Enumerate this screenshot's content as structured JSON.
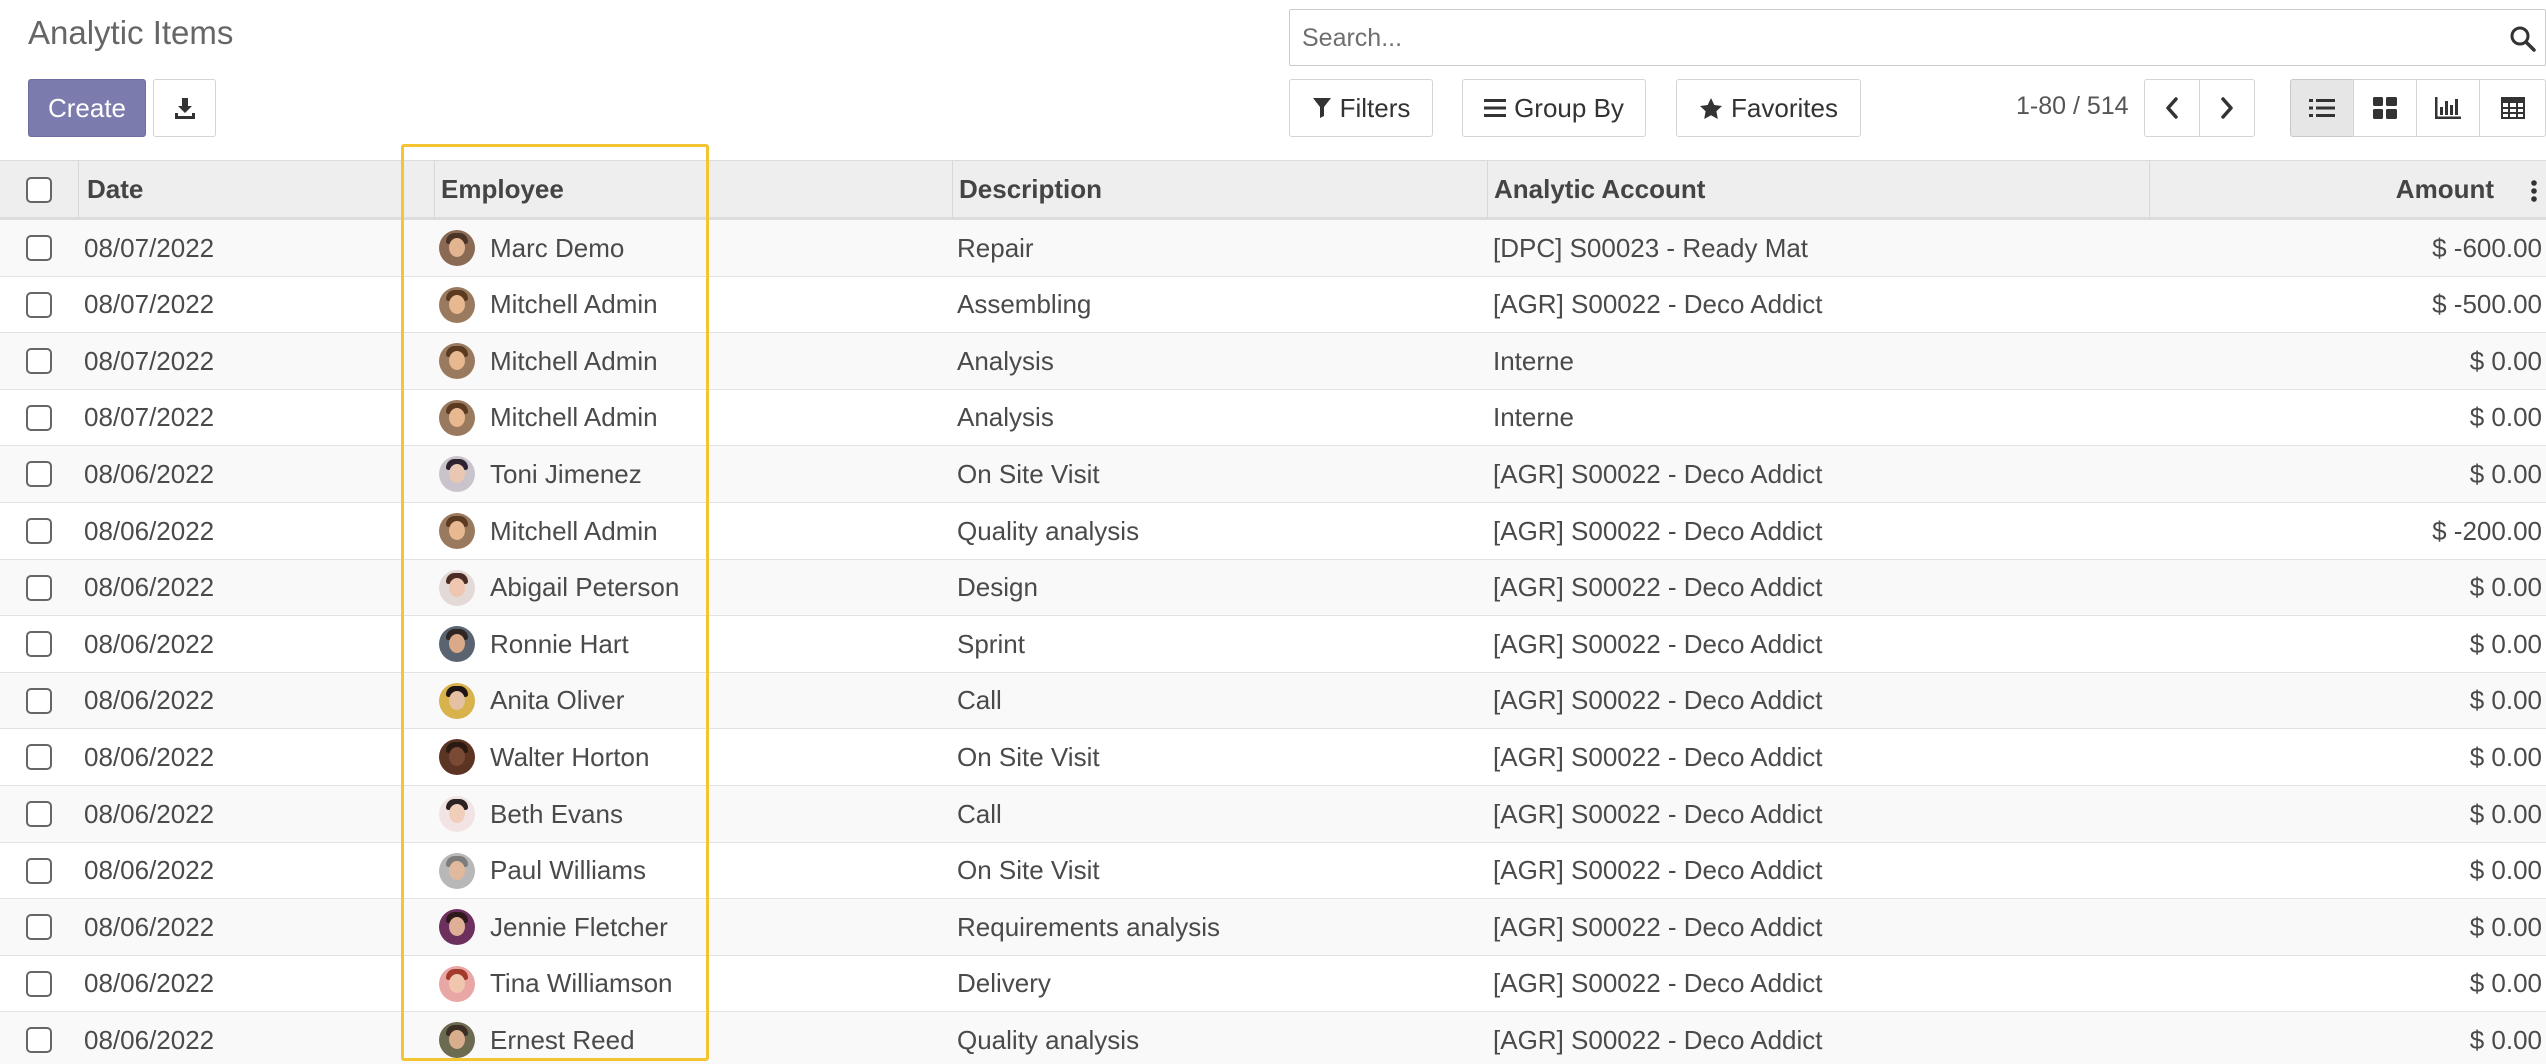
{
  "control_panel": {
    "title": "Analytic Items",
    "create_label": "Create",
    "search_placeholder": "Search...",
    "filters_label": "Filters",
    "groupby_label": "Group By",
    "favorites_label": "Favorites",
    "pager_value": "1-80 / 514",
    "accent_color": "#7c7bad"
  },
  "table": {
    "headers": {
      "date": "Date",
      "employee": "Employee",
      "description": "Description",
      "account": "Analytic Account",
      "amount": "Amount"
    },
    "rows": [
      {
        "date": "08/07/2022",
        "employee": "Marc Demo",
        "description": "Repair",
        "account": "[DPC] S00023 - Ready Mat",
        "amount": "$ -600.00"
      },
      {
        "date": "08/07/2022",
        "employee": "Mitchell Admin",
        "description": "Assembling",
        "account": "[AGR] S00022 - Deco Addict",
        "amount": "$ -500.00"
      },
      {
        "date": "08/07/2022",
        "employee": "Mitchell Admin",
        "description": "Analysis",
        "account": "Interne",
        "amount": "$ 0.00"
      },
      {
        "date": "08/07/2022",
        "employee": "Mitchell Admin",
        "description": "Analysis",
        "account": "Interne",
        "amount": "$ 0.00"
      },
      {
        "date": "08/06/2022",
        "employee": "Toni Jimenez",
        "description": "On Site Visit",
        "account": "[AGR] S00022 - Deco Addict",
        "amount": "$ 0.00"
      },
      {
        "date": "08/06/2022",
        "employee": "Mitchell Admin",
        "description": "Quality analysis",
        "account": "[AGR] S00022 - Deco Addict",
        "amount": "$ -200.00"
      },
      {
        "date": "08/06/2022",
        "employee": "Abigail Peterson",
        "description": "Design",
        "account": "[AGR] S00022 - Deco Addict",
        "amount": "$ 0.00"
      },
      {
        "date": "08/06/2022",
        "employee": "Ronnie Hart",
        "description": "Sprint",
        "account": "[AGR] S00022 - Deco Addict",
        "amount": "$ 0.00"
      },
      {
        "date": "08/06/2022",
        "employee": "Anita Oliver",
        "description": "Call",
        "account": "[AGR] S00022 - Deco Addict",
        "amount": "$ 0.00"
      },
      {
        "date": "08/06/2022",
        "employee": "Walter Horton",
        "description": "On Site Visit",
        "account": "[AGR] S00022 - Deco Addict",
        "amount": "$ 0.00"
      },
      {
        "date": "08/06/2022",
        "employee": "Beth Evans",
        "description": "Call",
        "account": "[AGR] S00022 - Deco Addict",
        "amount": "$ 0.00"
      },
      {
        "date": "08/06/2022",
        "employee": "Paul Williams",
        "description": "On Site Visit",
        "account": "[AGR] S00022 - Deco Addict",
        "amount": "$ 0.00"
      },
      {
        "date": "08/06/2022",
        "employee": "Jennie Fletcher",
        "description": "Requirements analysis",
        "account": "[AGR] S00022 - Deco Addict",
        "amount": "$ 0.00"
      },
      {
        "date": "08/06/2022",
        "employee": "Tina Williamson",
        "description": "Delivery",
        "account": "[AGR] S00022 - Deco Addict",
        "amount": "$ 0.00"
      },
      {
        "date": "08/06/2022",
        "employee": "Ernest Reed",
        "description": "Quality analysis",
        "account": "[AGR] S00022 - Deco Addict",
        "amount": "$ 0.00"
      }
    ]
  },
  "avatar_colors": {
    "Marc Demo": [
      "#8a6a55",
      "#e2b48f",
      "#4a3426"
    ],
    "Mitchell Admin": [
      "#9a7a5e",
      "#e8b890",
      "#5a3b22"
    ],
    "Toni Jimenez": [
      "#c9c4cc",
      "#e9c7b3",
      "#2e2230"
    ],
    "Abigail Peterson": [
      "#e3d9d6",
      "#efc7b1",
      "#4b2b25"
    ],
    "Ronnie Hart": [
      "#5a6470",
      "#d9a98a",
      "#2f2522"
    ],
    "Anita Oliver": [
      "#d8b24a",
      "#e6c0a2",
      "#1f1613"
    ],
    "Walter Horton": [
      "#5b3424",
      "#7a4a34",
      "#2a1a12"
    ],
    "Beth Evans": [
      "#f2e4e4",
      "#f1ceb9",
      "#2c2222"
    ],
    "Paul Williams": [
      "#b8b8b8",
      "#e1b99c",
      "#7c7c7c"
    ],
    "Jennie Fletcher": [
      "#6d2f5e",
      "#e0b096",
      "#2e1a1a"
    ],
    "Tina Williamson": [
      "#e8a7a4",
      "#f0c6ae",
      "#a33a2c"
    ],
    "Ernest Reed": [
      "#6c6a50",
      "#d9ae8c",
      "#3a2f22"
    ]
  }
}
